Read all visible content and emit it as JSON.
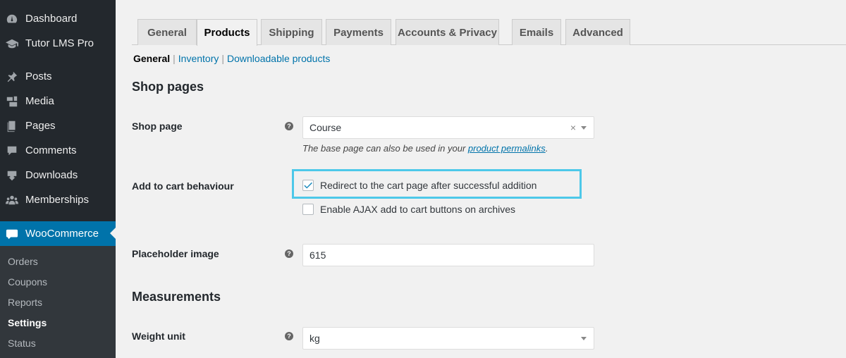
{
  "sidebar": {
    "items": [
      {
        "label": "Dashboard",
        "icon": "dashboard-icon"
      },
      {
        "label": "Tutor LMS Pro",
        "icon": "graduation-cap-icon"
      },
      {
        "label": "Posts",
        "icon": "pushpin-icon"
      },
      {
        "label": "Media",
        "icon": "media-icon"
      },
      {
        "label": "Pages",
        "icon": "pages-icon"
      },
      {
        "label": "Comments",
        "icon": "comment-icon"
      },
      {
        "label": "Downloads",
        "icon": "download-icon"
      },
      {
        "label": "Memberships",
        "icon": "groups-icon"
      },
      {
        "label": "WooCommerce",
        "icon": "woocommerce-icon"
      }
    ],
    "submenu": [
      "Orders",
      "Coupons",
      "Reports",
      "Settings",
      "Status"
    ],
    "active_item": "WooCommerce",
    "current_submenu": "Settings"
  },
  "tabs": [
    "General",
    "Products",
    "Shipping",
    "Payments",
    "Accounts & Privacy",
    "Emails",
    "Advanced"
  ],
  "active_tab": "Products",
  "subnav": {
    "current": "General",
    "links": [
      "Inventory",
      "Downloadable products"
    ],
    "separator": "|"
  },
  "sections": {
    "shop_pages": "Shop pages",
    "measurements": "Measurements"
  },
  "fields": {
    "shop_page": {
      "label": "Shop page",
      "value": "Course",
      "clear": "×",
      "desc_prefix": "The base page can also be used in your ",
      "desc_link": "product permalinks",
      "desc_suffix": "."
    },
    "add_to_cart": {
      "label": "Add to cart behaviour",
      "option1": "Redirect to the cart page after successful addition",
      "option1_checked": true,
      "option2": "Enable AJAX add to cart buttons on archives",
      "option2_checked": false
    },
    "placeholder_image": {
      "label": "Placeholder image",
      "value": "615"
    },
    "weight_unit": {
      "label": "Weight unit",
      "value": "kg"
    }
  },
  "help_glyph": "?",
  "colors": {
    "sidebar_bg": "#23282d",
    "submenu_bg": "#32373c",
    "active_bg": "#0073aa",
    "link": "#0073aa",
    "highlight": "#4dc8e9"
  }
}
